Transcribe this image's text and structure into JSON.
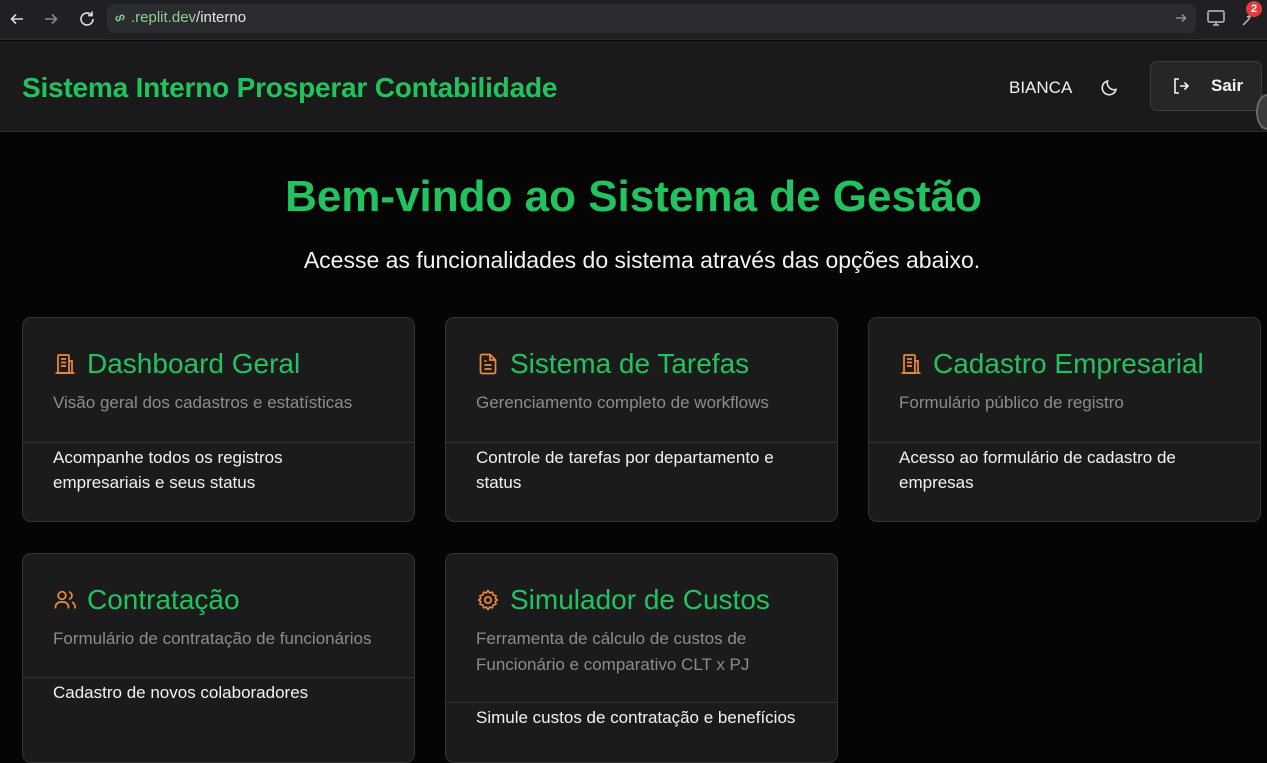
{
  "browser": {
    "url_domain": ".replit.dev",
    "url_path": "/interno",
    "extension_badge": "2"
  },
  "header": {
    "title": "Sistema Interno Prosperar Contabilidade",
    "user": "BIANCA",
    "logout_label": "Sair"
  },
  "hero": {
    "title": "Bem-vindo ao Sistema de Gestão",
    "subtitle": "Acesse as funcionalidades do sistema através das opções abaixo."
  },
  "cards": [
    {
      "icon": "building-icon",
      "title": "Dashboard Geral",
      "description": "Visão geral dos cadastros e estatísticas",
      "body": "Acompanhe todos os registros empresariais e seus status"
    },
    {
      "icon": "file-text-icon",
      "title": "Sistema de Tarefas",
      "description": "Gerenciamento completo de workflows",
      "body": "Controle de tarefas por departamento e status"
    },
    {
      "icon": "building-icon",
      "title": "Cadastro Empresarial",
      "description": "Formulário público de registro",
      "body": "Acesso ao formulário de cadastro de empresas"
    },
    {
      "icon": "users-icon",
      "title": "Contratação",
      "description": "Formulário de contratação de funcionários",
      "body": "Cadastro de novos colaboradores"
    },
    {
      "icon": "gear-icon",
      "title": "Simulador de Custos",
      "description": "Ferramenta de cálculo de custos de Funcionário e comparativo CLT x PJ",
      "body": "Simule custos de contratação e benefícios"
    }
  ],
  "colors": {
    "accent_green": "#22c35e",
    "icon_orange": "#f08a3c",
    "background": "#050505",
    "card_bg": "#1b1b1b"
  }
}
